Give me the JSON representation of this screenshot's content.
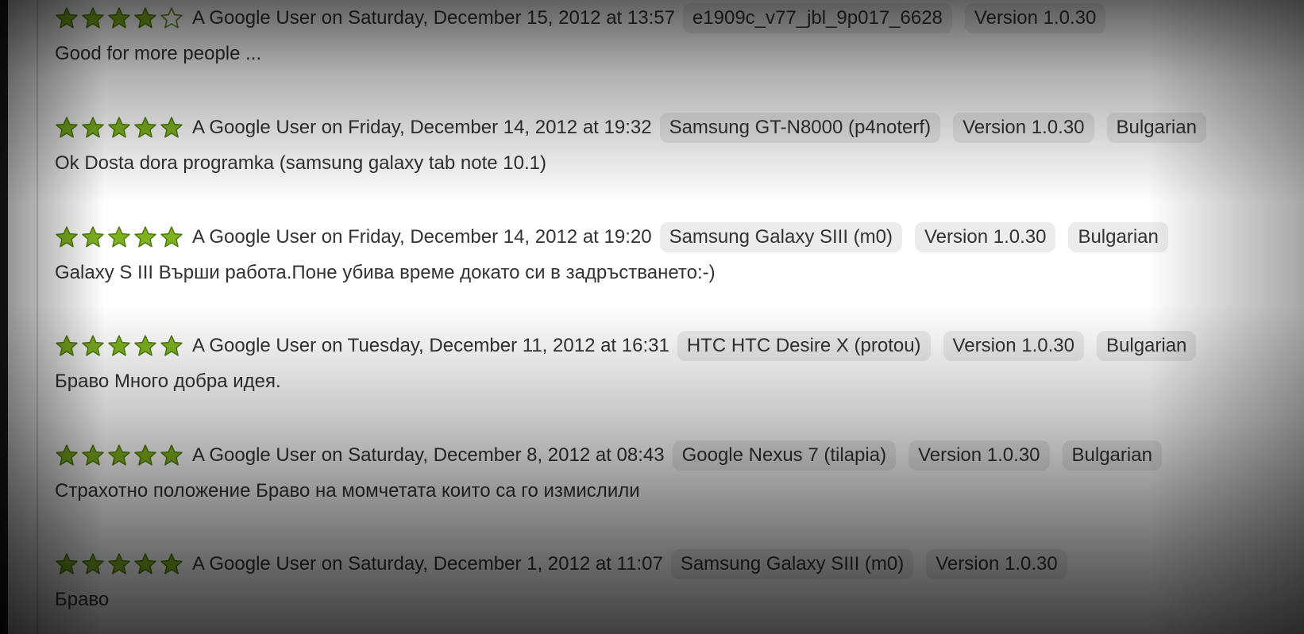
{
  "colors": {
    "star_fill": "#7fb21f",
    "star_stroke": "#4e7d0e",
    "star_empty_stroke": "#6a8a2a",
    "chip_background": "#ececec",
    "text": "#333333"
  },
  "icons": {
    "filled_star": "star-filled-icon",
    "empty_star": "star-empty-icon"
  },
  "reviews": [
    {
      "rating": 4,
      "author_line": "A Google User on Saturday, December 15, 2012 at 13:57",
      "tags": [
        "e1909c_v77_jbl_9p017_6628",
        "Version 1.0.30"
      ],
      "text": "Good for more people ..."
    },
    {
      "rating": 5,
      "author_line": "A Google User on Friday, December 14, 2012 at 19:32",
      "tags": [
        "Samsung GT-N8000 (p4noterf)",
        "Version 1.0.30",
        "Bulgarian"
      ],
      "text": "Ok Dosta dora programka (samsung galaxy tab note 10.1)"
    },
    {
      "rating": 5,
      "author_line": "A Google User on Friday, December 14, 2012 at 19:20",
      "tags": [
        "Samsung Galaxy SIII (m0)",
        "Version 1.0.30",
        "Bulgarian"
      ],
      "text": "Galaxy S III Върши работа.Поне убива време докато си в задръстването:-)"
    },
    {
      "rating": 5,
      "author_line": "A Google User on Tuesday, December 11, 2012 at 16:31",
      "tags": [
        "HTC HTC Desire X (protou)",
        "Version 1.0.30",
        "Bulgarian"
      ],
      "text": "Браво Много добра идея."
    },
    {
      "rating": 5,
      "author_line": "A Google User on Saturday, December 8, 2012 at 08:43",
      "tags": [
        "Google Nexus 7 (tilapia)",
        "Version 1.0.30",
        "Bulgarian"
      ],
      "text": "Страхотно положение Браво на момчетата които са го измислили"
    },
    {
      "rating": 5,
      "author_line": "A Google User on Saturday, December 1, 2012 at 11:07",
      "tags": [
        "Samsung Galaxy SIII (m0)",
        "Version 1.0.30"
      ],
      "text": "Браво"
    }
  ]
}
